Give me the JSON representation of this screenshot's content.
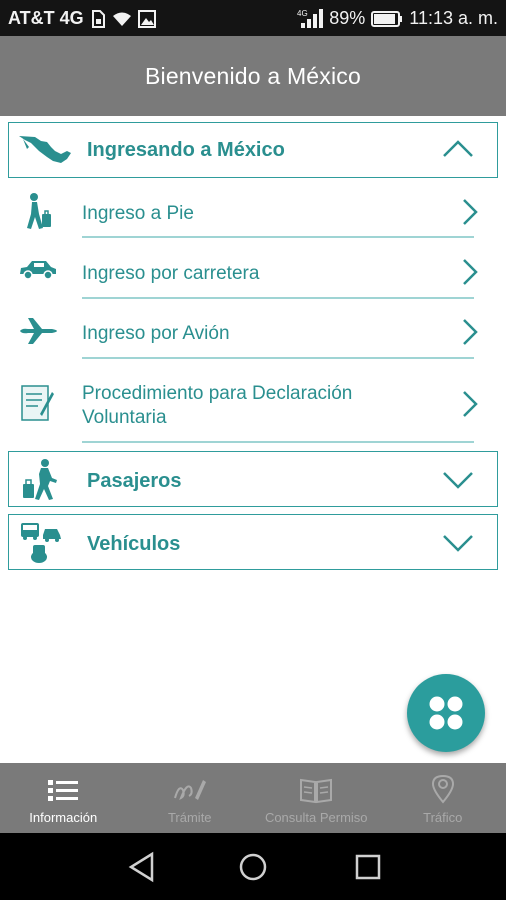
{
  "status_bar": {
    "carrier": "AT&T 4G",
    "battery_percent": "89%",
    "time": "11:13 a. m.",
    "network_badge": "4G"
  },
  "app_bar": {
    "title": "Bienvenido a México"
  },
  "sections": [
    {
      "label": "Ingresando a México",
      "expanded": true,
      "icon": "mexico-map-icon",
      "items": [
        {
          "label": "Ingreso a Pie",
          "icon": "walking-traveler-icon"
        },
        {
          "label": "Ingreso por carretera",
          "icon": "car-icon"
        },
        {
          "label": "Ingreso por Avión",
          "icon": "airplane-icon"
        },
        {
          "label_line1": "Procedimiento para Declaración",
          "label_line2": "Voluntaria",
          "icon": "declaration-form-icon"
        }
      ]
    },
    {
      "label": "Pasajeros",
      "expanded": false,
      "icon": "passenger-icon"
    },
    {
      "label": "Vehículos",
      "expanded": false,
      "icon": "vehicles-icon"
    }
  ],
  "fab": {
    "icon": "four-dots-grid-icon"
  },
  "bottom_nav": {
    "tabs": [
      {
        "label": "Información",
        "icon": "list-icon",
        "active": true
      },
      {
        "label": "Trámite",
        "icon": "signature-pen-icon",
        "active": false
      },
      {
        "label": "Consulta Permiso",
        "icon": "book-icon",
        "active": false
      },
      {
        "label": "Tráfico",
        "icon": "location-pin-icon",
        "active": false
      }
    ]
  },
  "colors": {
    "accent": "#2a8f8f",
    "header_gray": "#7a7a7a",
    "divider": "#9fd4d4"
  }
}
